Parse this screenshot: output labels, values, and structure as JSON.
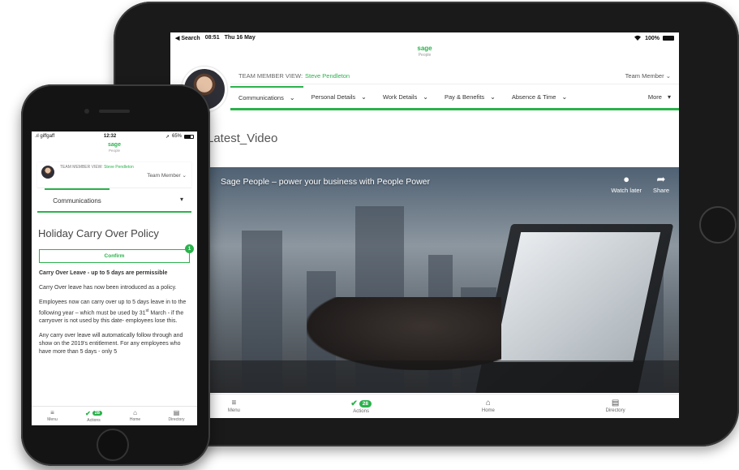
{
  "tablet": {
    "status": {
      "back_label": "◀ Search",
      "time": "08:51",
      "date": "Thu 16 May",
      "wifi_icon": "wifi-icon",
      "battery": "100%",
      "battery_level": 1.0
    },
    "brand": {
      "logo": "sage",
      "sub": "People"
    },
    "view_label": "TEAM MEMBER VIEW:",
    "view_name": "Steve Pendleton",
    "role": "Team Member",
    "tabs": [
      {
        "label": "Communications"
      },
      {
        "label": "Personal Details"
      },
      {
        "label": "Work Details"
      },
      {
        "label": "Pay & Benefits"
      },
      {
        "label": "Absence & Time"
      }
    ],
    "more_label": "More",
    "page_title": "Latest_Video",
    "video": {
      "title": "Sage People – power your business with People Power",
      "watch_later": "Watch later",
      "share": "Share"
    },
    "bottom_nav": {
      "menu": "Menu",
      "actions": "Actions",
      "actions_count": "28",
      "home": "Home",
      "directory": "Directory"
    }
  },
  "phone": {
    "status": {
      "carrier": "giffgaff",
      "time": "12:32",
      "battery": "65%",
      "battery_level": 0.65
    },
    "brand": {
      "logo": "sage",
      "sub": "People"
    },
    "view_label": "TEAM MEMBER VIEW:",
    "view_name": "Steve Pendleton",
    "role": "Team Member",
    "nav_tab": "Communications",
    "page_title": "Holiday Carry Over Policy",
    "confirm_label": "Confirm",
    "confirm_count": "1",
    "body": {
      "heading": "Carry Over Leave - up to 5 days are permissible",
      "p1": "Carry Over leave has now been introduced as a policy.",
      "p2_a": "Employees now can carry over up to 5 days leave in to the following year – which must be used by 31",
      "p2_sup": "st",
      "p2_b": " March - if the carryover is not used by this date- employees lose this.",
      "p3": "Any carry over leave will automatically follow through and show on the 2019's entitlement. For any employees who have more than 5 days - only 5"
    },
    "bottom_nav": {
      "menu": "Menu",
      "actions": "Actions",
      "actions_count": "28",
      "home": "Home",
      "directory": "Directory"
    }
  }
}
